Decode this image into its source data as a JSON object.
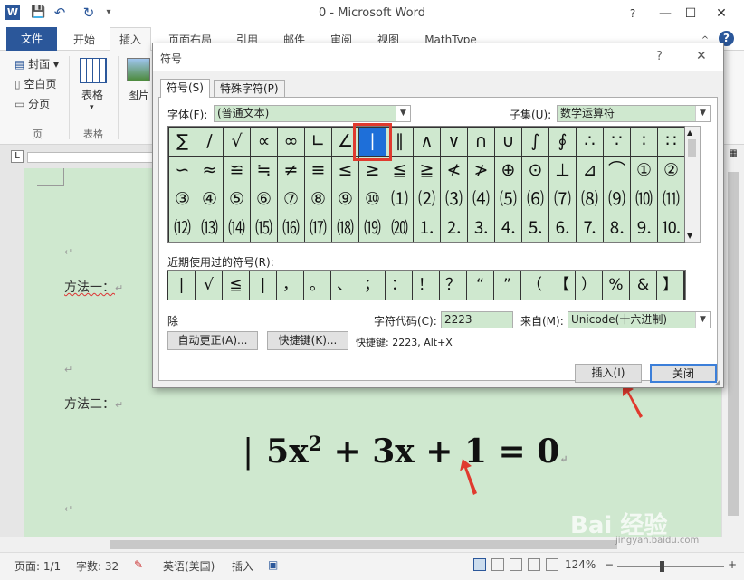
{
  "window": {
    "title": "0  -  Microsoft Word",
    "minimize": "—",
    "maximize": "☐",
    "close": "✕",
    "help": "?",
    "ribbon_toggle": "^"
  },
  "quick_access": {
    "word_icon": "W",
    "save": "💾",
    "undo": "↶",
    "redo": "↻",
    "customize": "▾"
  },
  "tabs": [
    "文件",
    "开始",
    "插入",
    "页面布局",
    "引用",
    "邮件",
    "审阅",
    "视图",
    "MathType"
  ],
  "ribbon": {
    "pages_group": {
      "items": [
        "封面",
        "空白页",
        "分页"
      ],
      "label": "页"
    },
    "tables_group": {
      "button": "表格",
      "label": "表格"
    },
    "picture_button": "图片"
  },
  "document": {
    "method1": "方法一：",
    "method2": "方法二：",
    "equation": {
      "bar": "|",
      "a": "5x",
      "exp": "2",
      "rest": " + 3x + 1 = 0"
    },
    "paragraph_mark": "↵"
  },
  "dialog": {
    "title": "符号",
    "help": "?",
    "close": "✕",
    "tabs": [
      "符号(S)",
      "特殊字符(P)"
    ],
    "font_label": "字体(F):",
    "font_value": "(普通文本)",
    "subset_label": "子集(U):",
    "subset_value": "数学运算符",
    "symbols": [
      [
        "∑",
        "∕",
        "√",
        "∝",
        "∞",
        "∟",
        "∠",
        "∣",
        "∥",
        "∧",
        "∨",
        "∩",
        "∪",
        "∫",
        "∮",
        "∴",
        "∵",
        "∶",
        "∷"
      ],
      [
        "∽",
        "≈",
        "≌",
        "≒",
        "≠",
        "≡",
        "≤",
        "≥",
        "≦",
        "≧",
        "≮",
        "≯",
        "⊕",
        "⊙",
        "⊥",
        "⊿",
        "⌒",
        "①",
        "②"
      ],
      [
        "③",
        "④",
        "⑤",
        "⑥",
        "⑦",
        "⑧",
        "⑨",
        "⑩",
        "⑴",
        "⑵",
        "⑶",
        "⑷",
        "⑸",
        "⑹",
        "⑺",
        "⑻",
        "⑼",
        "⑽",
        "⑾"
      ],
      [
        "⑿",
        "⒀",
        "⒁",
        "⒂",
        "⒃",
        "⒄",
        "⒅",
        "⒆",
        "⒇",
        "⒈",
        "⒉",
        "⒊",
        "⒋",
        "⒌",
        "⒍",
        "⒎",
        "⒏",
        "⒐",
        "⒑"
      ]
    ],
    "selected_symbol": {
      "row": 0,
      "col": 7
    },
    "recent_label": "近期使用过的符号(R):",
    "recent": [
      "|",
      "√",
      "≦",
      "|",
      "，",
      "。",
      "、",
      "；",
      "：",
      "！",
      "？",
      "“",
      "”",
      "（",
      "【",
      "）",
      "%",
      "&",
      "】"
    ],
    "char_name": "除",
    "char_code_label": "字符代码(C):",
    "char_code_value": "2223",
    "from_label": "来自(M):",
    "from_value": "Unicode(十六进制)",
    "autocorrect_button": "自动更正(A)...",
    "shortcut_button": "快捷键(K)...",
    "shortcut_text": "快捷键: 2223, Alt+X",
    "insert_button": "插入(I)",
    "close_button": "关闭"
  },
  "status_bar": {
    "page": "页面: 1/1",
    "words": "字数: 32",
    "language": "英语(美国)",
    "mode": "插入",
    "zoom": "124%",
    "zoom_minus": "−",
    "zoom_plus": "+"
  },
  "watermark": {
    "text": "Bai 经验",
    "url": "jingyan.baidu.com"
  },
  "colors": {
    "word_blue": "#2b579a",
    "selection_blue": "#1e6fd9",
    "page_green": "#cfe8cf",
    "highlight_red": "#e03a2e"
  }
}
